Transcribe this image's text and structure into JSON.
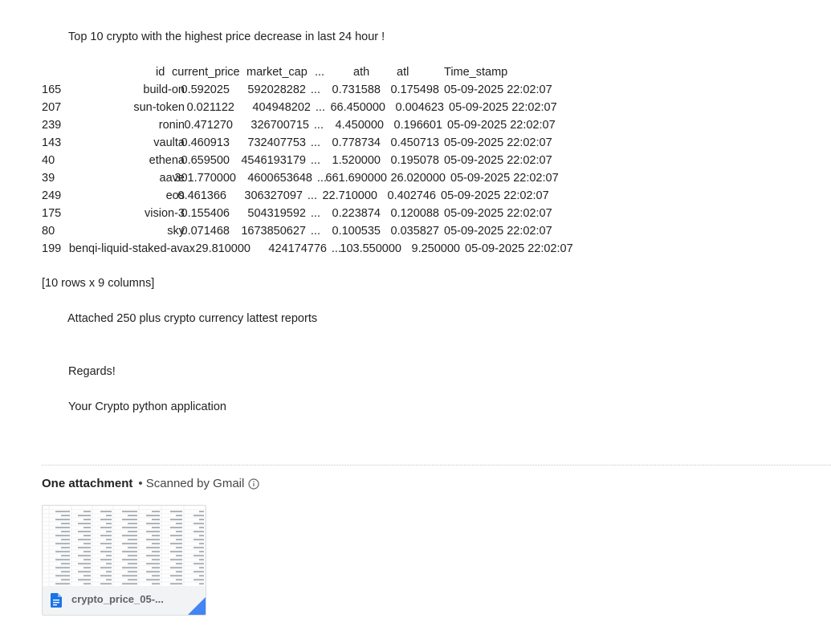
{
  "email": {
    "heading": "Top 10 crypto with the highest price decrease in last 24 hour !",
    "table": {
      "header_id": "id",
      "header_price": "current_price",
      "header_cap": "market_cap",
      "header_ellipsis": "...",
      "header_ath": "ath",
      "header_atl": "atl",
      "header_time": "Time_stamp",
      "rows": [
        {
          "idx": "165",
          "id": "build-on",
          "price": "0.592025",
          "cap": "592028282",
          "ell": "...",
          "ath": "0.731588",
          "atl": "0.175498",
          "time": "05-09-2025 22:02:07"
        },
        {
          "idx": "207",
          "id": "sun-token",
          "price": "0.021122",
          "cap": "404948202",
          "ell": "...",
          "ath": "66.450000",
          "atl": "0.004623",
          "time": "05-09-2025 22:02:07"
        },
        {
          "idx": "239",
          "id": "ronin",
          "price": "0.471270",
          "cap": "326700715",
          "ell": "...",
          "ath": "4.450000",
          "atl": "0.196601",
          "time": "05-09-2025 22:02:07"
        },
        {
          "idx": "143",
          "id": "vaulta",
          "price": "0.460913",
          "cap": "732407753",
          "ell": "...",
          "ath": "0.778734",
          "atl": "0.450713",
          "time": "05-09-2025 22:02:07"
        },
        {
          "idx": "40",
          "id": "ethena",
          "price": "0.659500",
          "cap": "4546193179",
          "ell": "...",
          "ath": "1.520000",
          "atl": "0.195078",
          "time": "05-09-2025 22:02:07"
        },
        {
          "idx": "39",
          "id": "aave",
          "price": "301.770000",
          "cap": "4600653648",
          "ell": "...",
          "ath": "661.690000",
          "atl": "26.020000",
          "time": "05-09-2025 22:02:07"
        },
        {
          "idx": "249",
          "id": "eos",
          "price": "0.461366",
          "cap": "306327097",
          "ell": "...",
          "ath": "22.710000",
          "atl": "0.402746",
          "time": "05-09-2025 22:02:07"
        },
        {
          "idx": "175",
          "id": "vision-3",
          "price": "0.155406",
          "cap": "504319592",
          "ell": "...",
          "ath": "0.223874",
          "atl": "0.120088",
          "time": "05-09-2025 22:02:07"
        },
        {
          "idx": "80",
          "id": "sky",
          "price": "0.071468",
          "cap": "1673850627",
          "ell": "...",
          "ath": "0.100535",
          "atl": "0.035827",
          "time": "05-09-2025 22:02:07"
        },
        {
          "idx": "199",
          "id": "benqi-liquid-staked-avax",
          "price": "29.810000",
          "cap": "424174776",
          "ell": "...",
          "ath": "103.550000",
          "atl": "9.250000",
          "time": "05-09-2025 22:02:07"
        }
      ],
      "summary": "[10 rows x 9 columns]"
    },
    "attached_text": "Attached 250 plus crypto currency lattest reports",
    "regards": "Regards!",
    "signature": "Your Crypto python application"
  },
  "attachments": {
    "title": "One attachment",
    "scan_status": "• Scanned by Gmail",
    "info_icon": "info-circle-icon",
    "file": {
      "name": "crypto_price_05-...",
      "icon": "google-sheets-file-icon",
      "icon_color": "#1a73e8"
    }
  }
}
